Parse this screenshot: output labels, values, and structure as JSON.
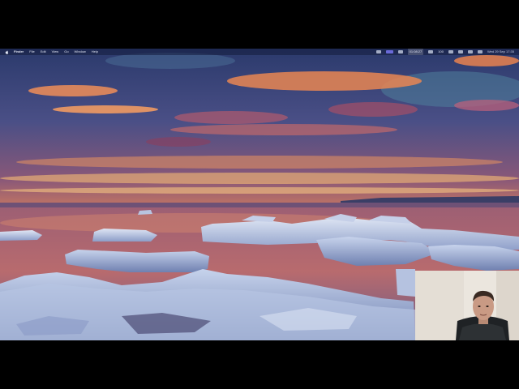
{
  "menubar": {
    "apple_icon": "apple-logo-icon",
    "items": [
      "Finder",
      "File",
      "Edit",
      "View",
      "Go",
      "Window",
      "Help"
    ],
    "timer": "01:08:27",
    "battery_label": "100",
    "clock": "Wed 29 Sep 17:35",
    "status_icons": [
      "recording-icon",
      "screen-share-icon",
      "timer-icon",
      "battery-icon",
      "wifi-icon",
      "control-center-icon",
      "siri-icon"
    ]
  },
  "wallpaper": {
    "description_icon": "desktop-wallpaper",
    "colors": {
      "sky_top": "#2c3a6e",
      "cloud_orange": "#e8834f",
      "horizon": "#f1b16a",
      "water": "#7b4a6a",
      "ice": "#b9c6e0"
    }
  },
  "webcam": {
    "icon": "webcam-overlay",
    "colors": {
      "wall": "#e9e4dc",
      "jacket": "#2a2d30",
      "skin": "#c99a84"
    }
  }
}
